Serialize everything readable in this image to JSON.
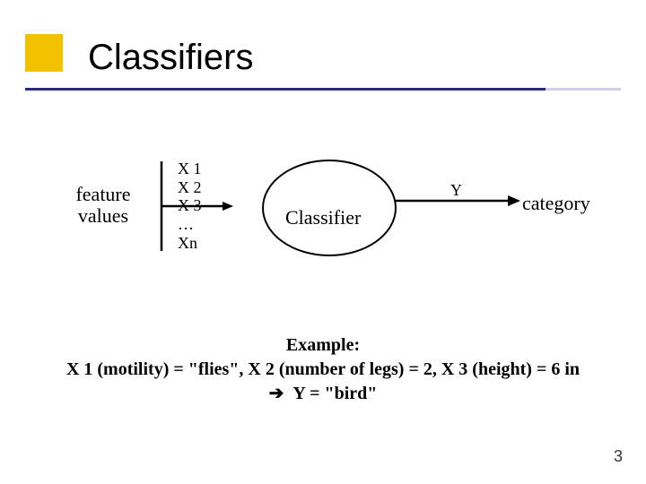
{
  "title": "Classifiers",
  "diagram": {
    "input_label_line1": "feature",
    "input_label_line2": "values",
    "features": [
      "X 1",
      "X 2",
      "X 3",
      "…",
      "Xn"
    ],
    "node_label": "Classifier",
    "output_var": "Y",
    "output_label": "category"
  },
  "example": {
    "heading": "Example:",
    "line1": "X 1 (motility) = \"flies\", X 2 (number of legs) = 2, X 3 (height) = 6 in",
    "result": "Y = \"bird\""
  },
  "page_number": "3"
}
